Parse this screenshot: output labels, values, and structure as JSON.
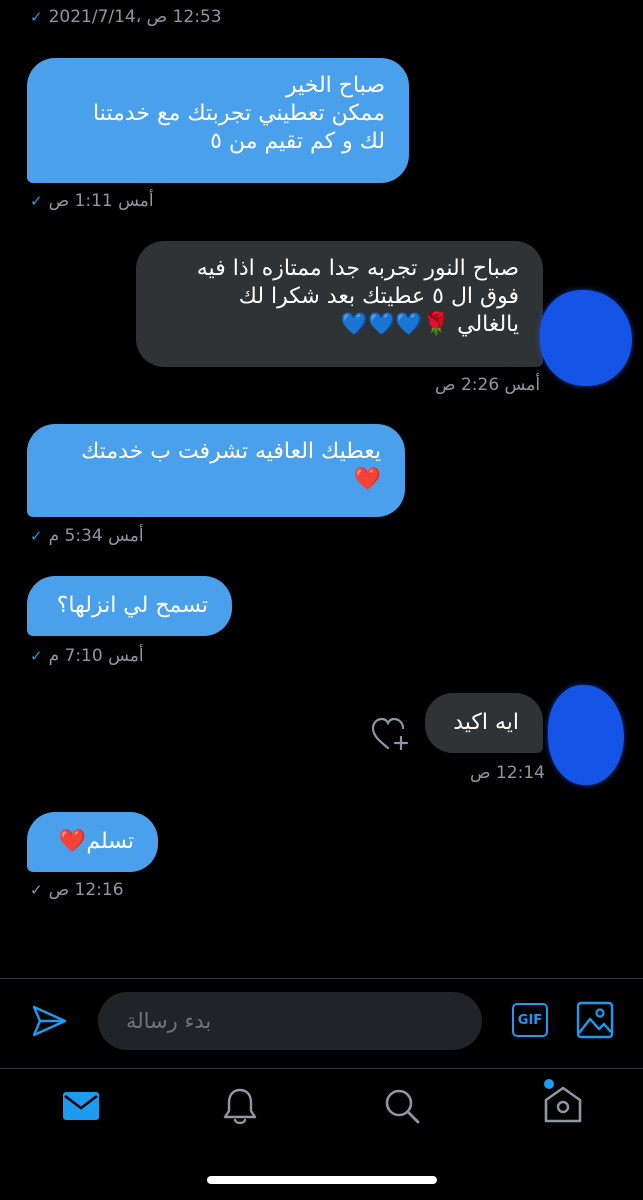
{
  "conversation": {
    "messages": [
      {
        "direction": "sent",
        "text": "",
        "meta": "12:53 ص ،2021/7/14",
        "read": true
      },
      {
        "direction": "sent",
        "text": "صباح الخير\nممكن تعطيني تجربتك مع خدمتنا\nلك و كم تقيم من ٥",
        "meta": "أمس 1:11 ص",
        "read": true
      },
      {
        "direction": "received",
        "text": "صباح النور تجربه جدا ممتازه اذا فيه\nفوق ال ٥ عطيتك بعد شكرا لك\nيالغالي 🌹💙💙💙",
        "meta": "أمس 2:26 ص"
      },
      {
        "direction": "sent",
        "text": "يعطيك العافيه تشرفت ب خدمتك\n❤️",
        "meta": "أمس 5:34 م",
        "read": true
      },
      {
        "direction": "sent",
        "text": "تسمح لي انزلها؟",
        "meta": "أمس 7:10 م",
        "read": true
      },
      {
        "direction": "received",
        "text": "ايه اكيد",
        "meta": "12:14 ص"
      },
      {
        "direction": "sent",
        "text": "تسلم❤️",
        "meta": "12:16 ص",
        "read": false
      }
    ]
  },
  "composer": {
    "placeholder": "بدء رسالة",
    "gif_label": "GIF"
  },
  "icons": {
    "send": "send-icon",
    "gif": "gif-icon",
    "image": "image-icon",
    "react": "heart-plus-icon",
    "tabs": [
      "mail-icon",
      "bell-icon",
      "search-icon",
      "home-icon"
    ]
  },
  "colors": {
    "sent_bubble": "#4aa0ea",
    "received_bubble": "#2f3336",
    "accent": "#1d9bf0"
  }
}
